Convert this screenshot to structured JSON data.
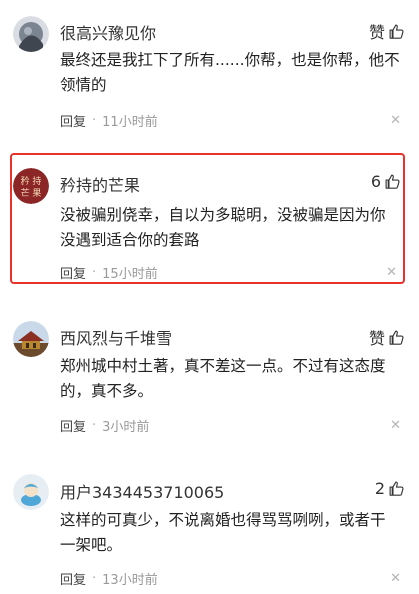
{
  "comments": [
    {
      "username": "很高兴豫见你",
      "text": "最终还是我扛下了所有......你帮，也是你帮，他不领情的",
      "likes": "赞",
      "reply_label": "回复",
      "separator": "·",
      "time": "11小时前",
      "close": "✕",
      "highlighted": false
    },
    {
      "username": "矜持的芒果",
      "text": "没被骗别侥幸，自以为多聪明，没被骗是因为你没遇到适合你的套路",
      "likes": "6",
      "reply_label": "回复",
      "separator": "·",
      "time": "15小时前",
      "close": "✕",
      "highlighted": true,
      "highlight_color": "#e8322b"
    },
    {
      "username": "西风烈与千堆雪",
      "text": "郑州城中村土著，真不差这一点。不过有这态度的，真不多。",
      "likes": "赞",
      "reply_label": "回复",
      "separator": "·",
      "time": "3小时前",
      "close": "✕",
      "highlighted": false
    },
    {
      "username": "用户3434453710065",
      "text": "这样的可真少，不说离婚也得骂骂咧咧，或者干一架吧。",
      "likes": "2",
      "reply_label": "回复",
      "separator": "·",
      "time": "13小时前",
      "close": "✕",
      "highlighted": false
    }
  ],
  "icons": {
    "like": "thumbs-up-icon",
    "close": "close-icon"
  }
}
